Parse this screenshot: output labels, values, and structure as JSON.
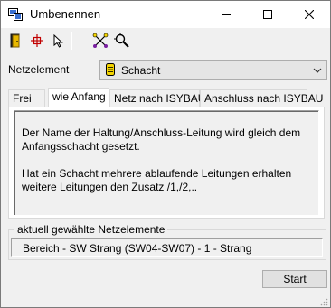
{
  "window": {
    "title": "Umbenennen",
    "icon": "network-app-icon"
  },
  "toolbar": {
    "buttons": [
      {
        "icon": "door-exit-icon"
      },
      {
        "icon": "crosshair-icon"
      },
      {
        "icon": "pointer-icon"
      },
      {
        "icon": "network-nodes-icon"
      },
      {
        "icon": "zoom-search-icon"
      }
    ]
  },
  "netzelement": {
    "label": "Netzelement",
    "selected": "Schacht",
    "icon": "manhole-icon"
  },
  "tabs": [
    {
      "label": "Frei",
      "active": false
    },
    {
      "label": "wie Anfang",
      "active": true
    },
    {
      "label": "Netz nach ISYBAU",
      "active": false
    },
    {
      "label": "Anschluss nach ISYBAU",
      "active": false
    }
  ],
  "description": {
    "line1": "Der Name der Haltung/Anschluss-Leitung wird gleich dem Anfangsschacht gesetzt.",
    "line2": "Hat ein Schacht mehrere ablaufende Leitungen erhalten weitere Leitungen den Zusatz /1,/2,.."
  },
  "selection": {
    "legend": "aktuell gewählte Netzelemente",
    "value": "Bereich - SW Strang (SW04-SW07) - 1 - Strang"
  },
  "start_label": "Start",
  "colors": {
    "dialog_bg": "#f0f0f0",
    "titlebar_bg": "#ffffff",
    "manhole_yellow": "#f4d400"
  }
}
